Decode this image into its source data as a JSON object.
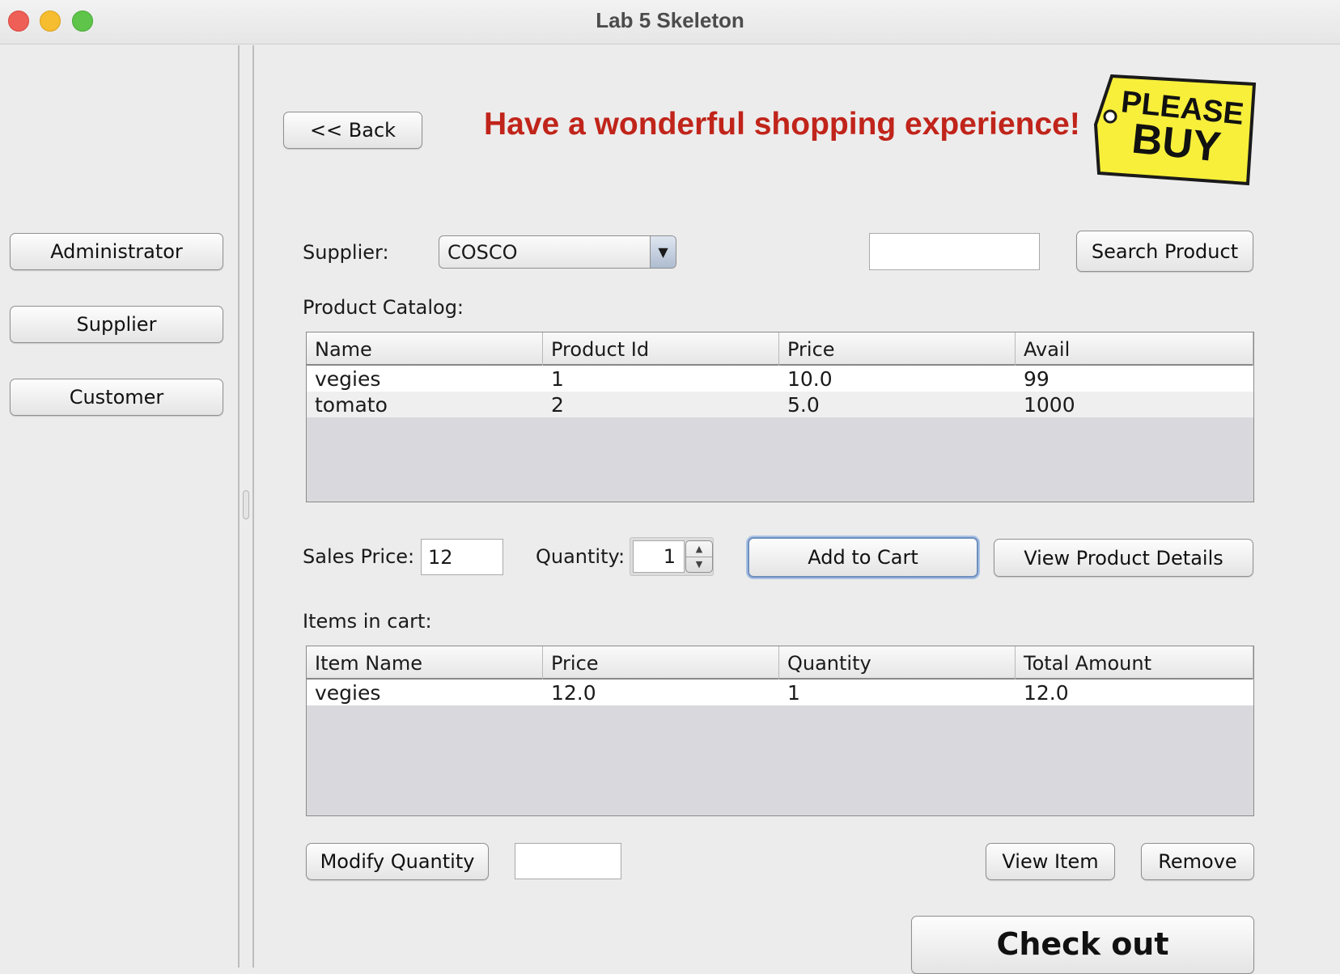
{
  "window": {
    "title": "Lab 5 Skeleton"
  },
  "sidebar": {
    "items": [
      {
        "label": "Administrator"
      },
      {
        "label": "Supplier"
      },
      {
        "label": "Customer"
      }
    ]
  },
  "header": {
    "back_label": "<< Back",
    "banner": "Have a wonderful shopping experience!",
    "logo_text": [
      "PLEASE",
      "BUY"
    ]
  },
  "supplier": {
    "label": "Supplier:",
    "selected": "COSCO"
  },
  "search": {
    "value": "",
    "button_label": "Search Product"
  },
  "catalog": {
    "label": "Product Catalog:",
    "columns": [
      "Name",
      "Product Id",
      "Price",
      "Avail"
    ],
    "rows": [
      [
        "vegies",
        "1",
        "10.0",
        "99"
      ],
      [
        "tomato",
        "2",
        "5.0",
        "1000"
      ]
    ]
  },
  "order": {
    "sales_price_label": "Sales Price:",
    "sales_price_value": "12",
    "quantity_label": "Quantity:",
    "quantity_value": "1",
    "add_to_cart_label": "Add to Cart",
    "view_details_label": "View Product Details"
  },
  "cart": {
    "label": "Items in cart:",
    "columns": [
      "Item Name",
      "Price",
      "Quantity",
      "Total Amount"
    ],
    "rows": [
      [
        "vegies",
        "12.0",
        "1",
        "12.0"
      ]
    ]
  },
  "cart_actions": {
    "modify_label": "Modify Quantity",
    "modify_value": "",
    "view_item_label": "View Item",
    "remove_label": "Remove",
    "checkout_label": "Check out"
  },
  "colors": {
    "banner": "#c0241a",
    "logo_yellow": "#f7ef3a",
    "focus_ring": "#a9c1e4"
  }
}
